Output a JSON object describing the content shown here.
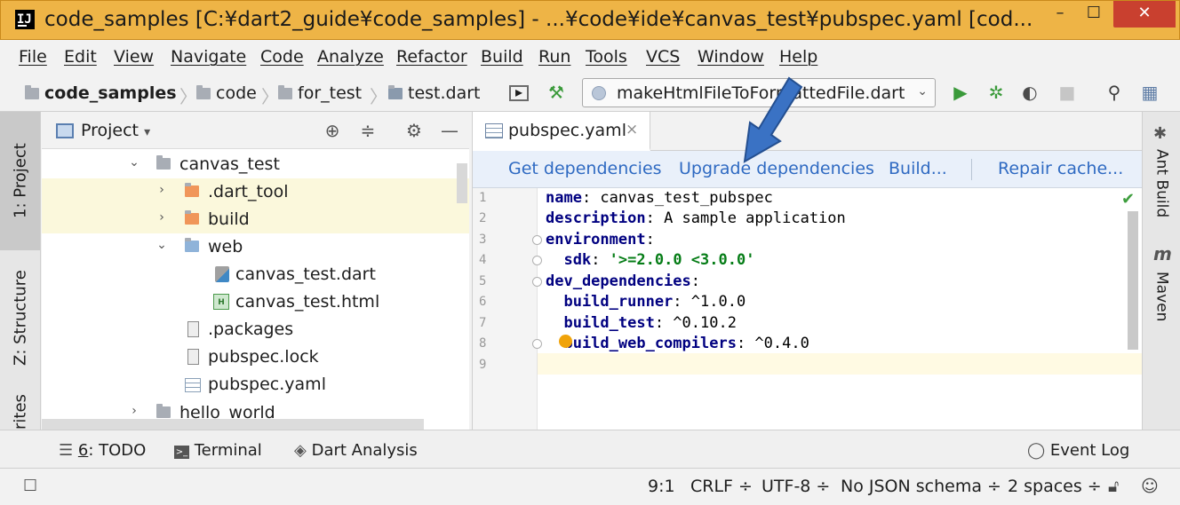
{
  "window": {
    "app_icon": "IJ",
    "title": "code_samples [C:¥dart2_guide¥code_samples] - ...¥code¥ide¥canvas_test¥pubspec.yaml [cod...",
    "minimize": "–",
    "maximize": "☐",
    "close": "✕"
  },
  "menu": [
    "File",
    "Edit",
    "View",
    "Navigate",
    "Code",
    "Analyze",
    "Refactor",
    "Build",
    "Run",
    "Tools",
    "VCS",
    "Window",
    "Help"
  ],
  "breadcrumb": [
    "code_samples",
    "code",
    "for_test",
    "test.dart"
  ],
  "run_config": {
    "label": "makeHtmlFileToFormattedFile.dart",
    "dropdown": "⌄"
  },
  "toolbar_icons": [
    "tool-window-icon",
    "build-hammer-icon",
    "run-icon",
    "debug-icon",
    "coverage-icon",
    "stop-icon",
    "search-icon",
    "project-structure-icon"
  ],
  "left_strip": {
    "project": "1: Project",
    "structure": "Z: Structure",
    "favorites": "rites"
  },
  "project_panel": {
    "title": "Project",
    "dropdown": "▾",
    "tree": [
      {
        "label": "canvas_test",
        "kind": "folder",
        "expanded": true
      },
      {
        "label": ".dart_tool",
        "kind": "folder-orange",
        "expanded": false
      },
      {
        "label": "build",
        "kind": "folder-orange",
        "expanded": false
      },
      {
        "label": "web",
        "kind": "folder-web",
        "expanded": true
      },
      {
        "label": "canvas_test.dart",
        "kind": "dart"
      },
      {
        "label": "canvas_test.html",
        "kind": "html"
      },
      {
        "label": ".packages",
        "kind": "file"
      },
      {
        "label": "pubspec.lock",
        "kind": "file"
      },
      {
        "label": "pubspec.yaml",
        "kind": "yaml"
      },
      {
        "label": "hello_world",
        "kind": "folder",
        "expanded": false
      }
    ]
  },
  "editor": {
    "tab": "pubspec.yaml",
    "tab_close": "×",
    "actions": [
      "Get dependencies",
      "Upgrade dependencies",
      "Build...",
      "Repair cache..."
    ],
    "line_numbers": [
      "1",
      "2",
      "3",
      "4",
      "5",
      "6",
      "7",
      "8",
      "9"
    ],
    "code": {
      "l1_key": "name",
      "l1_val": ": canvas_test_pubspec",
      "l2_key": "description",
      "l2_val": ": A sample application",
      "l3_key": "environment",
      "l3_val": ":",
      "l4_key": "  sdk",
      "l4_colon": ": ",
      "l4_val": "'>=2.0.0 <3.0.0'",
      "l5_key": "dev_dependencies",
      "l5_val": ":",
      "l6_key": "  build_runner",
      "l6_val": ": ^1.0.0",
      "l7_key": "  build_test",
      "l7_val": ": ^0.10.2",
      "l8_key": "  build_web_compilers",
      "l8_val": ": ^0.4.0"
    },
    "status_check": "✔"
  },
  "right_strip": {
    "ant": "Ant Build",
    "maven_icon": "m",
    "maven": "Maven"
  },
  "bottom_tools": {
    "todo_prefix": "6",
    "todo": ": TODO",
    "terminal": "Terminal",
    "dart_analysis": "Dart Analysis",
    "event_log": "Event Log"
  },
  "status": {
    "position": "9:1",
    "line_sep": "CRLF ÷",
    "encoding": "UTF-8 ÷",
    "schema": "No JSON schema ÷",
    "indent": "2 spaces ÷"
  },
  "colors": {
    "title_bar": "#eeb446",
    "close": "#c9402f",
    "link": "#2f6ac2",
    "annotation_arrow": "#3a72c4"
  }
}
